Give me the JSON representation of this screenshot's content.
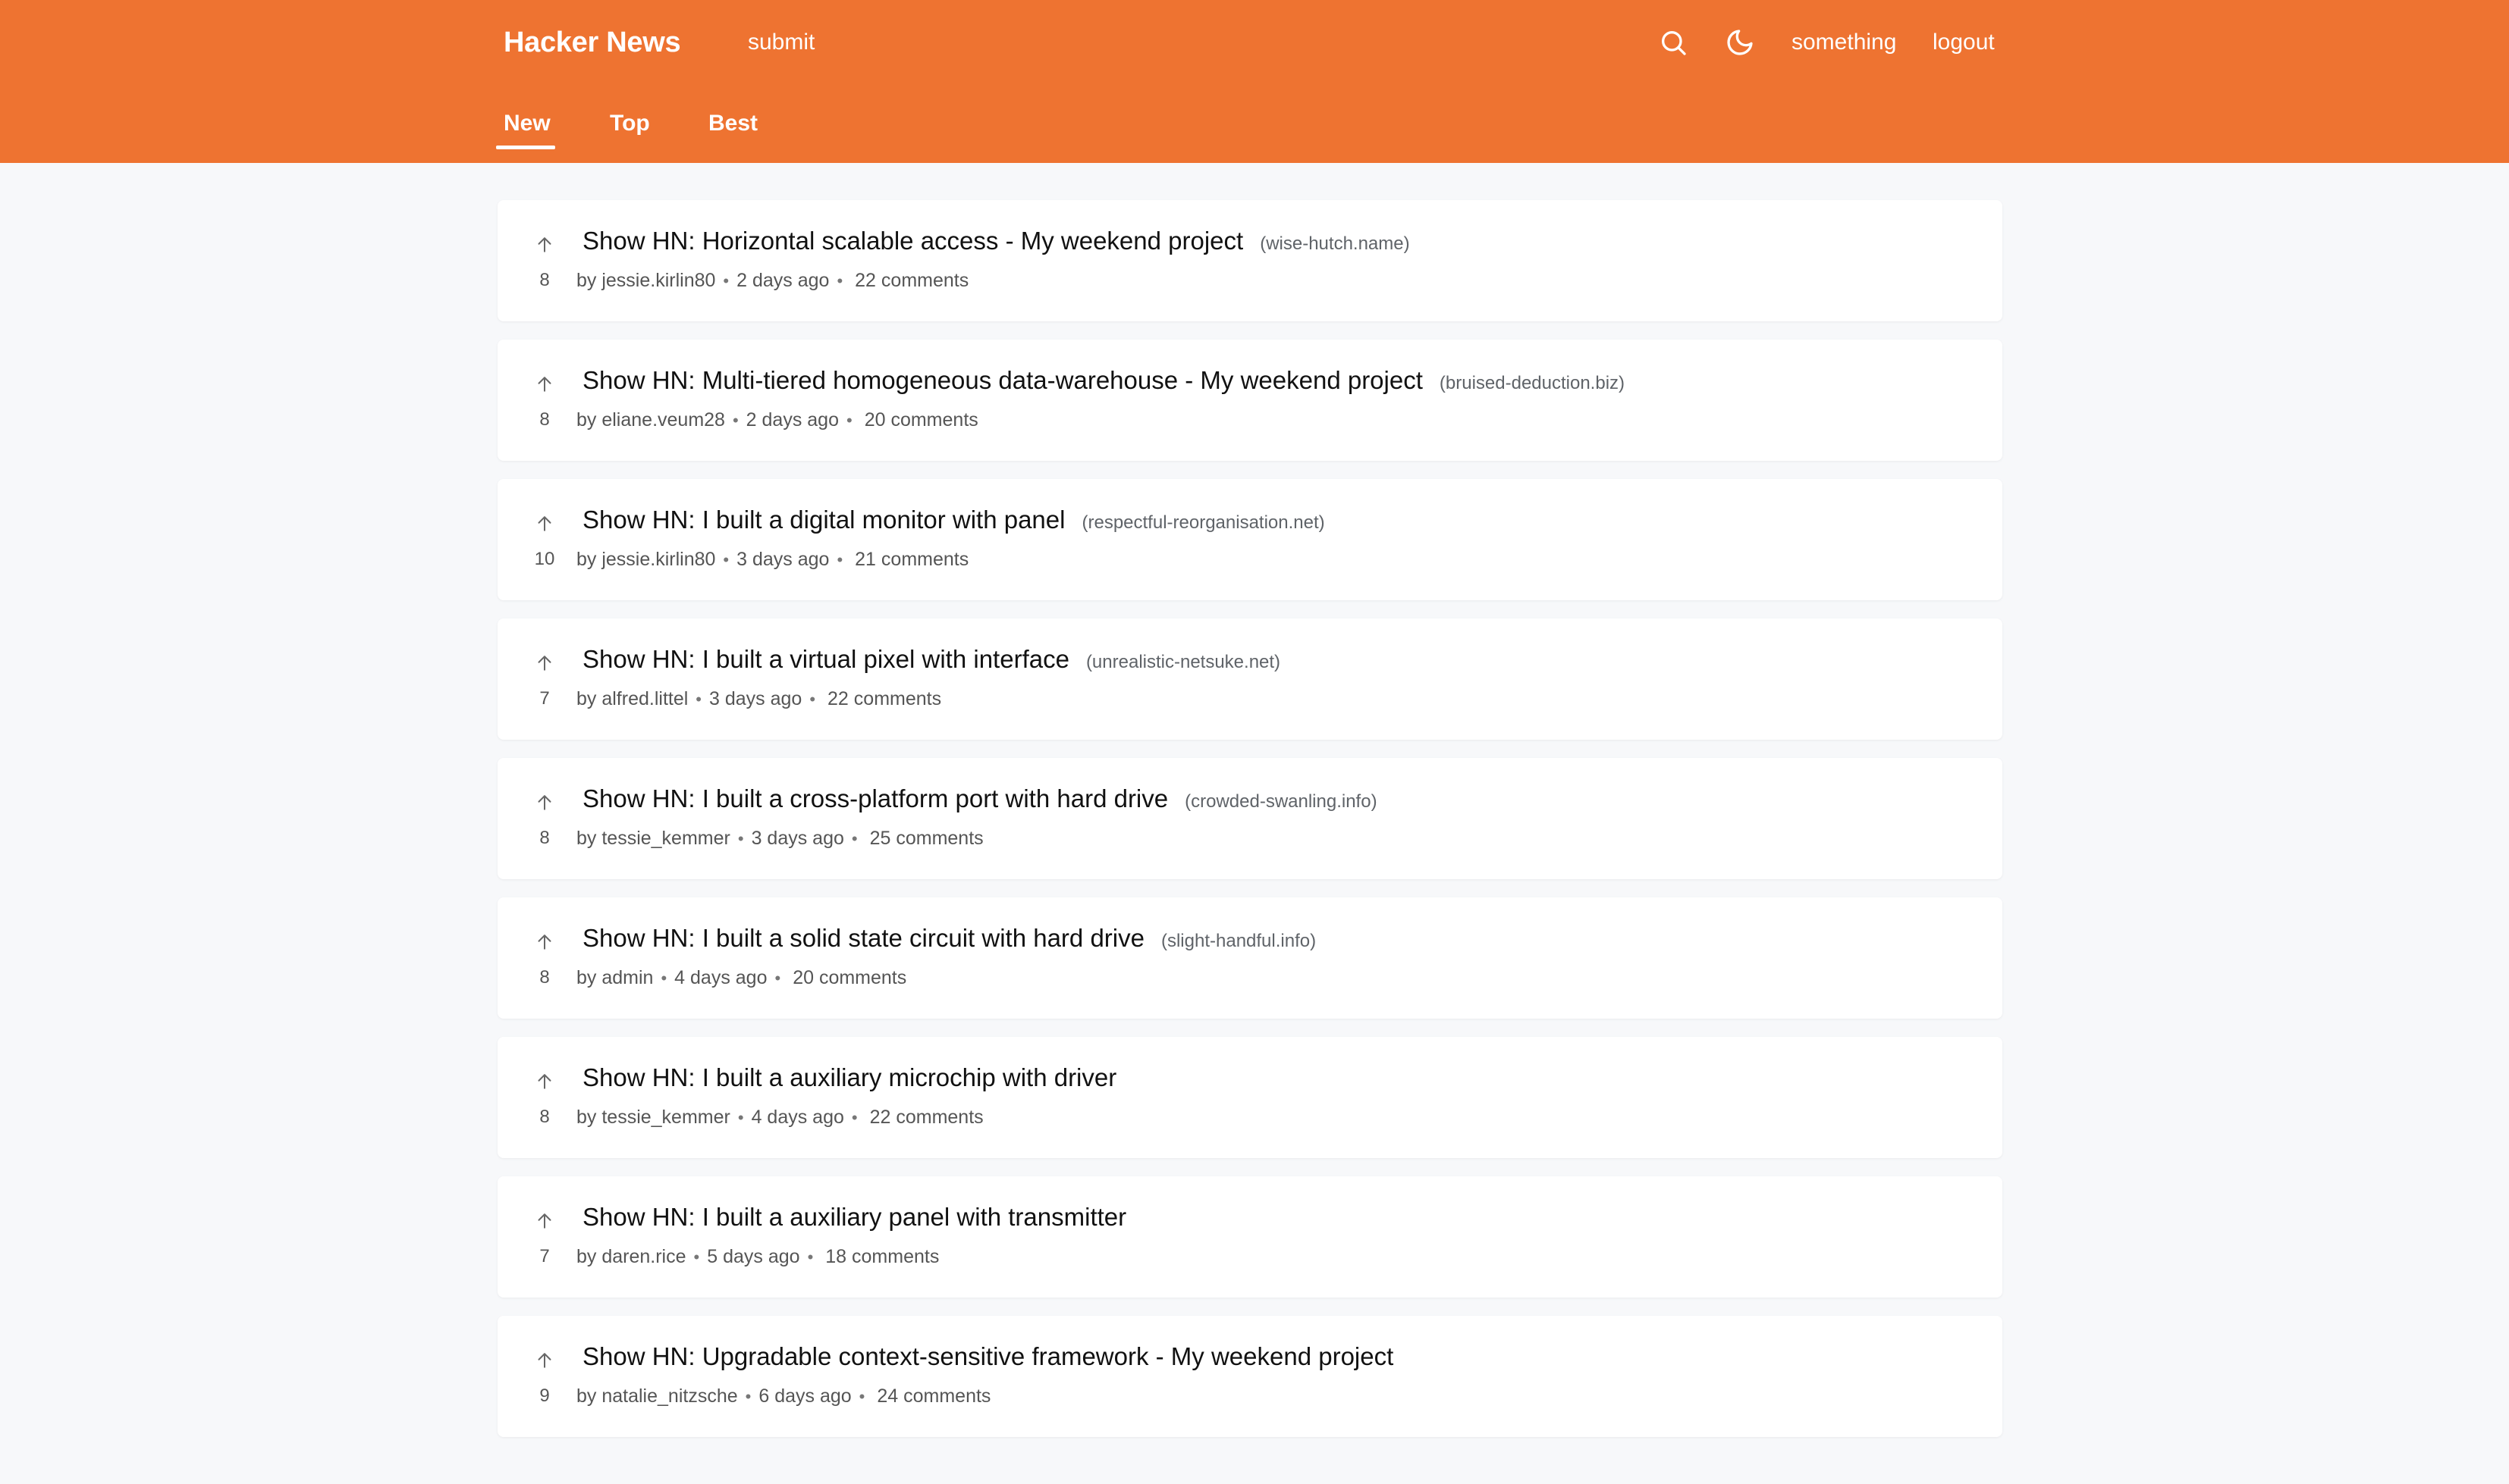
{
  "header": {
    "brand": "Hacker News",
    "submit_label": "submit",
    "username": "something",
    "logout_label": "logout",
    "icons": [
      "search-icon",
      "moon-icon"
    ],
    "accent_color": "#ee7331"
  },
  "tabs": [
    {
      "label": "New",
      "active": true
    },
    {
      "label": "Top",
      "active": false
    },
    {
      "label": "Best",
      "active": false
    }
  ],
  "stories": [
    {
      "title": "Show HN: Horizontal scalable access - My weekend project",
      "domain": "(wise-hutch.name)",
      "points": "8",
      "author": "by jessie.kirlin80",
      "time": "2 days ago",
      "comments": "22 comments"
    },
    {
      "title": "Show HN: Multi-tiered homogeneous data-warehouse - My weekend project",
      "domain": "(bruised-deduction.biz)",
      "points": "8",
      "author": "by eliane.veum28",
      "time": "2 days ago",
      "comments": "20 comments"
    },
    {
      "title": "Show HN: I built a digital monitor with panel",
      "domain": "(respectful-reorganisation.net)",
      "points": "10",
      "author": "by jessie.kirlin80",
      "time": "3 days ago",
      "comments": "21 comments"
    },
    {
      "title": "Show HN: I built a virtual pixel with interface",
      "domain": "(unrealistic-netsuke.net)",
      "points": "7",
      "author": "by alfred.littel",
      "time": "3 days ago",
      "comments": "22 comments"
    },
    {
      "title": "Show HN: I built a cross-platform port with hard drive",
      "domain": "(crowded-swanling.info)",
      "points": "8",
      "author": "by tessie_kemmer",
      "time": "3 days ago",
      "comments": "25 comments"
    },
    {
      "title": "Show HN: I built a solid state circuit with hard drive",
      "domain": "(slight-handful.info)",
      "points": "8",
      "author": "by admin",
      "time": "4 days ago",
      "comments": "20 comments"
    },
    {
      "title": "Show HN: I built a auxiliary microchip with driver",
      "domain": "",
      "points": "8",
      "author": "by tessie_kemmer",
      "time": "4 days ago",
      "comments": "22 comments"
    },
    {
      "title": "Show HN: I built a auxiliary panel with transmitter",
      "domain": "",
      "points": "7",
      "author": "by daren.rice",
      "time": "5 days ago",
      "comments": "18 comments"
    },
    {
      "title": "Show HN: Upgradable context-sensitive framework - My weekend project",
      "domain": "",
      "points": "9",
      "author": "by natalie_nitzsche",
      "time": "6 days ago",
      "comments": "24 comments"
    }
  ]
}
